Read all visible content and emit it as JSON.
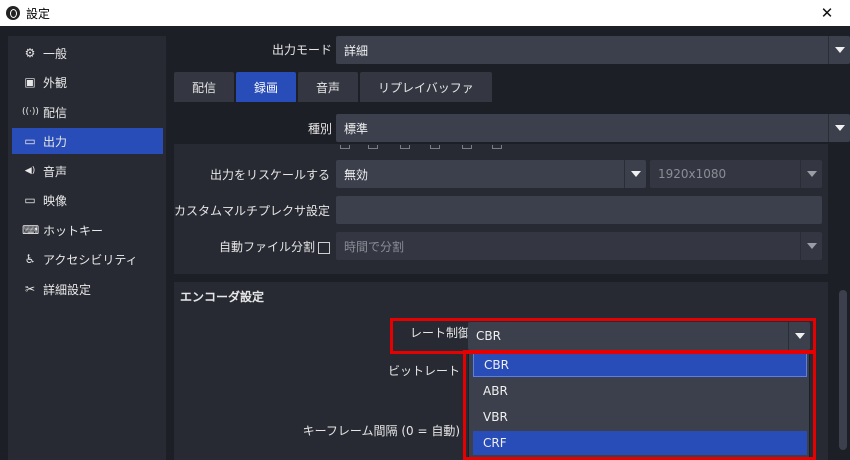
{
  "window": {
    "title": "設定",
    "close": "✕"
  },
  "sidebar": {
    "items": [
      {
        "icon": "gear-icon",
        "glyph": "⚙",
        "label": "一般"
      },
      {
        "icon": "appearance-icon",
        "glyph": "▣",
        "label": "外観"
      },
      {
        "icon": "stream-icon",
        "glyph": "((·))",
        "label": "配信"
      },
      {
        "icon": "output-icon",
        "glyph": "▭",
        "label": "出力"
      },
      {
        "icon": "audio-icon",
        "glyph": "◀)",
        "label": "音声"
      },
      {
        "icon": "video-icon",
        "glyph": "▭",
        "label": "映像"
      },
      {
        "icon": "keyboard-icon",
        "glyph": "⌨",
        "label": "ホットキー"
      },
      {
        "icon": "accessibility-icon",
        "glyph": "♿",
        "label": "アクセシビリティ"
      },
      {
        "icon": "tools-icon",
        "glyph": "✂",
        "label": "詳細設定"
      }
    ],
    "active_index": 3
  },
  "output_mode": {
    "label": "出力モード",
    "value": "詳細"
  },
  "tabs": [
    "配信",
    "録画",
    "音声",
    "リプレイバッファ"
  ],
  "active_tab": 1,
  "type": {
    "label": "種別",
    "value": "標準"
  },
  "rescale": {
    "label": "出力をリスケールする",
    "value": "無効",
    "resolution": "1920x1080"
  },
  "muxer": {
    "label": "カスタムマルチプレクサ設定",
    "value": ""
  },
  "autosplit": {
    "label": "自動ファイル分割",
    "value": "時間で分割"
  },
  "encoder": {
    "title": "エンコーダ設定",
    "rate_control": {
      "label": "レート制御",
      "value": "CBR"
    },
    "bitrate_label": "ビットレート",
    "keyframe_label": "キーフレーム間隔 (0 = 自動)",
    "options": [
      "CBR",
      "ABR",
      "VBR",
      "CRF"
    ]
  },
  "colors": {
    "accent": "#284cb8",
    "highlight_box": "#e60000"
  }
}
